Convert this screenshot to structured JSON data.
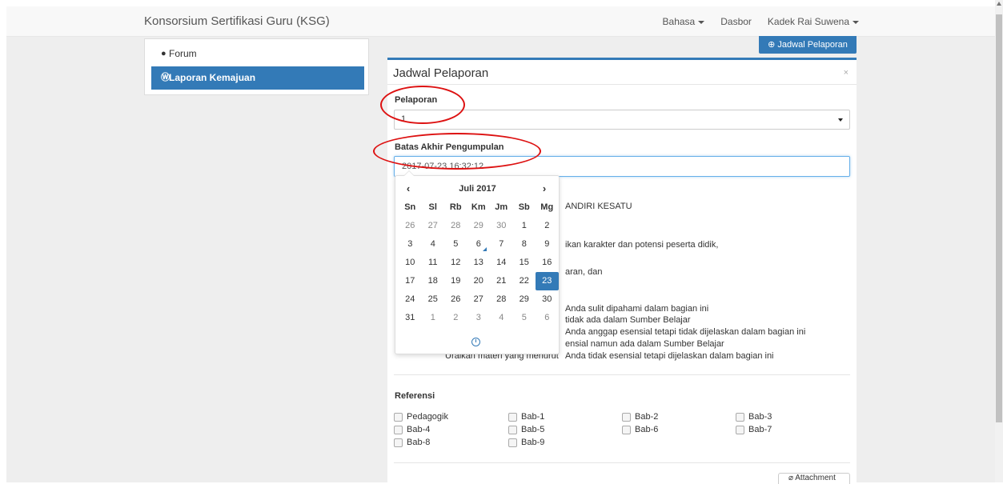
{
  "navbar": {
    "brand": "Konsorsium Sertifikasi Guru (KSG)",
    "items": [
      {
        "label": "Bahasa"
      },
      {
        "label": "Dasbor"
      },
      {
        "label": "Kadek Rai Suwena"
      }
    ]
  },
  "sidebar": {
    "items": [
      {
        "label": "Forum",
        "icon": "comment-icon",
        "active": false
      },
      {
        "label": "Laporan Kemajuan",
        "icon": "wordpress-icon",
        "active": true
      }
    ]
  },
  "top_button": {
    "label": "Jadwal Pelaporan",
    "icon": "plus-circle-icon"
  },
  "modal": {
    "title": "Jadwal Pelaporan",
    "close": "×",
    "pelaporan_label": "Pelaporan",
    "pelaporan_value": "1",
    "batas_label": "Batas Akhir Pengumpulan",
    "batas_value": "2017-07-23 16:32:12"
  },
  "background_text": {
    "line1": "ANDIRI KESATU",
    "line2": "ikan karakter dan potensi peserta didik,",
    "line3": "aran, dan",
    "line4": "Anda sulit dipahami dalam bagian ini",
    "line5": "tidak ada dalam Sumber Belajar",
    "line6": "Anda anggap esensial tetapi tidak dijelaskan dalam bagian ini",
    "line7": "ensial namun ada dalam Sumber Belajar",
    "line8a": "Uraikan materi yang menurut",
    "line8b": "Anda tidak esensial tetapi dijelaskan dalam bagian ini"
  },
  "calendar": {
    "prev": "‹",
    "next": "›",
    "month_title": "Juli 2017",
    "weekdays": [
      "Sn",
      "Sl",
      "Rb",
      "Km",
      "Jm",
      "Sb",
      "Mg"
    ],
    "days": [
      [
        "26",
        "27",
        "28",
        "29",
        "30",
        "1",
        "2"
      ],
      [
        "3",
        "4",
        "5",
        "6",
        "7",
        "8",
        "9"
      ],
      [
        "10",
        "11",
        "12",
        "13",
        "14",
        "15",
        "16"
      ],
      [
        "17",
        "18",
        "19",
        "20",
        "21",
        "22",
        "23"
      ],
      [
        "24",
        "25",
        "26",
        "27",
        "28",
        "29",
        "30"
      ],
      [
        "31",
        "1",
        "2",
        "3",
        "4",
        "5",
        "6"
      ]
    ],
    "selected_day": "23",
    "today_day": "6",
    "accent_color": "#337ab7"
  },
  "referensi": {
    "label": "Referensi",
    "options": [
      "Pedagogik",
      "Bab-1",
      "Bab-2",
      "Bab-3",
      "Bab-4",
      "Bab-5",
      "Bab-6",
      "Bab-7",
      "Bab-8",
      "Bab-9"
    ]
  },
  "attachment_label": "Attachment",
  "annotation_color": "#dd1111"
}
